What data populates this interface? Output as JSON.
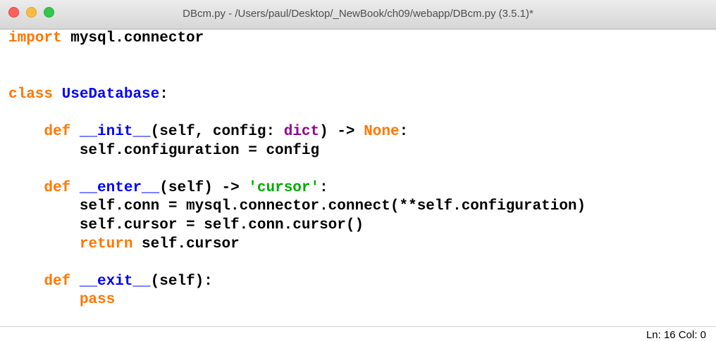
{
  "window": {
    "title": "DBcm.py - /Users/paul/Desktop/_NewBook/ch09/webapp/DBcm.py (3.5.1)*"
  },
  "editor": {
    "lines": [
      [
        {
          "t": "kw",
          "v": "import"
        },
        {
          "t": "plain",
          "v": " mysql.connector"
        }
      ],
      [],
      [],
      [
        {
          "t": "kw",
          "v": "class"
        },
        {
          "t": "plain",
          "v": " "
        },
        {
          "t": "def",
          "v": "UseDatabase"
        },
        {
          "t": "plain",
          "v": ":"
        }
      ],
      [],
      [
        {
          "t": "plain",
          "v": "    "
        },
        {
          "t": "kw",
          "v": "def"
        },
        {
          "t": "plain",
          "v": " "
        },
        {
          "t": "def",
          "v": "__init__"
        },
        {
          "t": "plain",
          "v": "(self, config: "
        },
        {
          "t": "bi",
          "v": "dict"
        },
        {
          "t": "plain",
          "v": ") -> "
        },
        {
          "t": "kw",
          "v": "None"
        },
        {
          "t": "plain",
          "v": ":"
        }
      ],
      [
        {
          "t": "plain",
          "v": "        self.configuration = config"
        }
      ],
      [],
      [
        {
          "t": "plain",
          "v": "    "
        },
        {
          "t": "kw",
          "v": "def"
        },
        {
          "t": "plain",
          "v": " "
        },
        {
          "t": "def",
          "v": "__enter__"
        },
        {
          "t": "plain",
          "v": "(self) -> "
        },
        {
          "t": "str",
          "v": "'cursor'"
        },
        {
          "t": "plain",
          "v": ":"
        }
      ],
      [
        {
          "t": "plain",
          "v": "        self.conn = mysql.connector.connect(**self.configuration)"
        }
      ],
      [
        {
          "t": "plain",
          "v": "        self.cursor = self.conn.cursor()"
        }
      ],
      [
        {
          "t": "plain",
          "v": "        "
        },
        {
          "t": "kw",
          "v": "return"
        },
        {
          "t": "plain",
          "v": " self.cursor"
        }
      ],
      [],
      [
        {
          "t": "plain",
          "v": "    "
        },
        {
          "t": "kw",
          "v": "def"
        },
        {
          "t": "plain",
          "v": " "
        },
        {
          "t": "def",
          "v": "__exit__"
        },
        {
          "t": "plain",
          "v": "(self):"
        }
      ],
      [
        {
          "t": "plain",
          "v": "        "
        },
        {
          "t": "kw",
          "v": "pass"
        }
      ]
    ]
  },
  "statusbar": {
    "position": "Ln: 16  Col: 0"
  },
  "colors": {
    "keyword": "#ff7700",
    "definition": "#0000ff",
    "builtin": "#900090",
    "string": "#00aa00"
  }
}
